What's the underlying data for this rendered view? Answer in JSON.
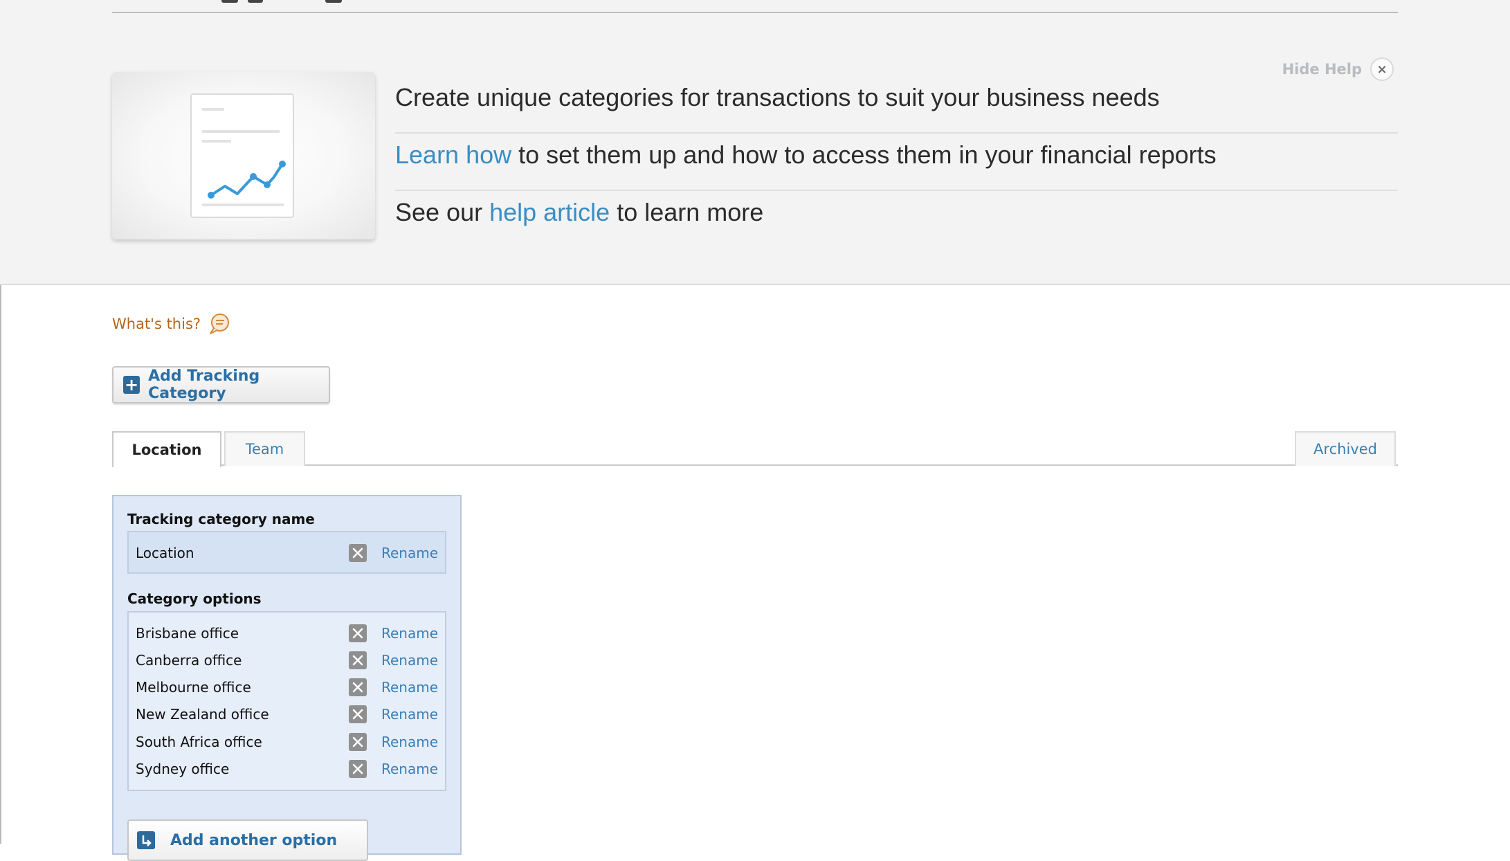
{
  "help": {
    "hide_help_label": "Hide Help",
    "lines": [
      {
        "text": "Create unique categories for transactions to suit your business needs"
      },
      {
        "link": "Learn how",
        "rest": " to set them up and how to access them in your financial reports"
      },
      {
        "pre": "See our ",
        "link": "help article",
        "post": " to learn more"
      }
    ]
  },
  "whats_this": "What's this?",
  "add_category_button": "Add Tracking Category",
  "tabs": [
    "Location",
    "Team"
  ],
  "archived_tab": "Archived",
  "category": {
    "name_label": "Tracking category name",
    "name": "Location",
    "options_label": "Category options",
    "rename_label": "Rename",
    "options": [
      "Brisbane office",
      "Canberra office",
      "Melbourne office",
      "New Zealand office",
      "South Africa office",
      "Sydney office"
    ],
    "add_option_label": "Add another option"
  },
  "colors": {
    "link": "#3a8dc3",
    "whats_this": "#b5651d",
    "button_icon": "#2e6a99",
    "panel_bg": "#dfe8f6"
  },
  "icons": [
    "chart-document-icon",
    "close-icon",
    "speech-bubble-icon",
    "plus-icon",
    "delete-x-icon",
    "return-arrow-icon"
  ]
}
